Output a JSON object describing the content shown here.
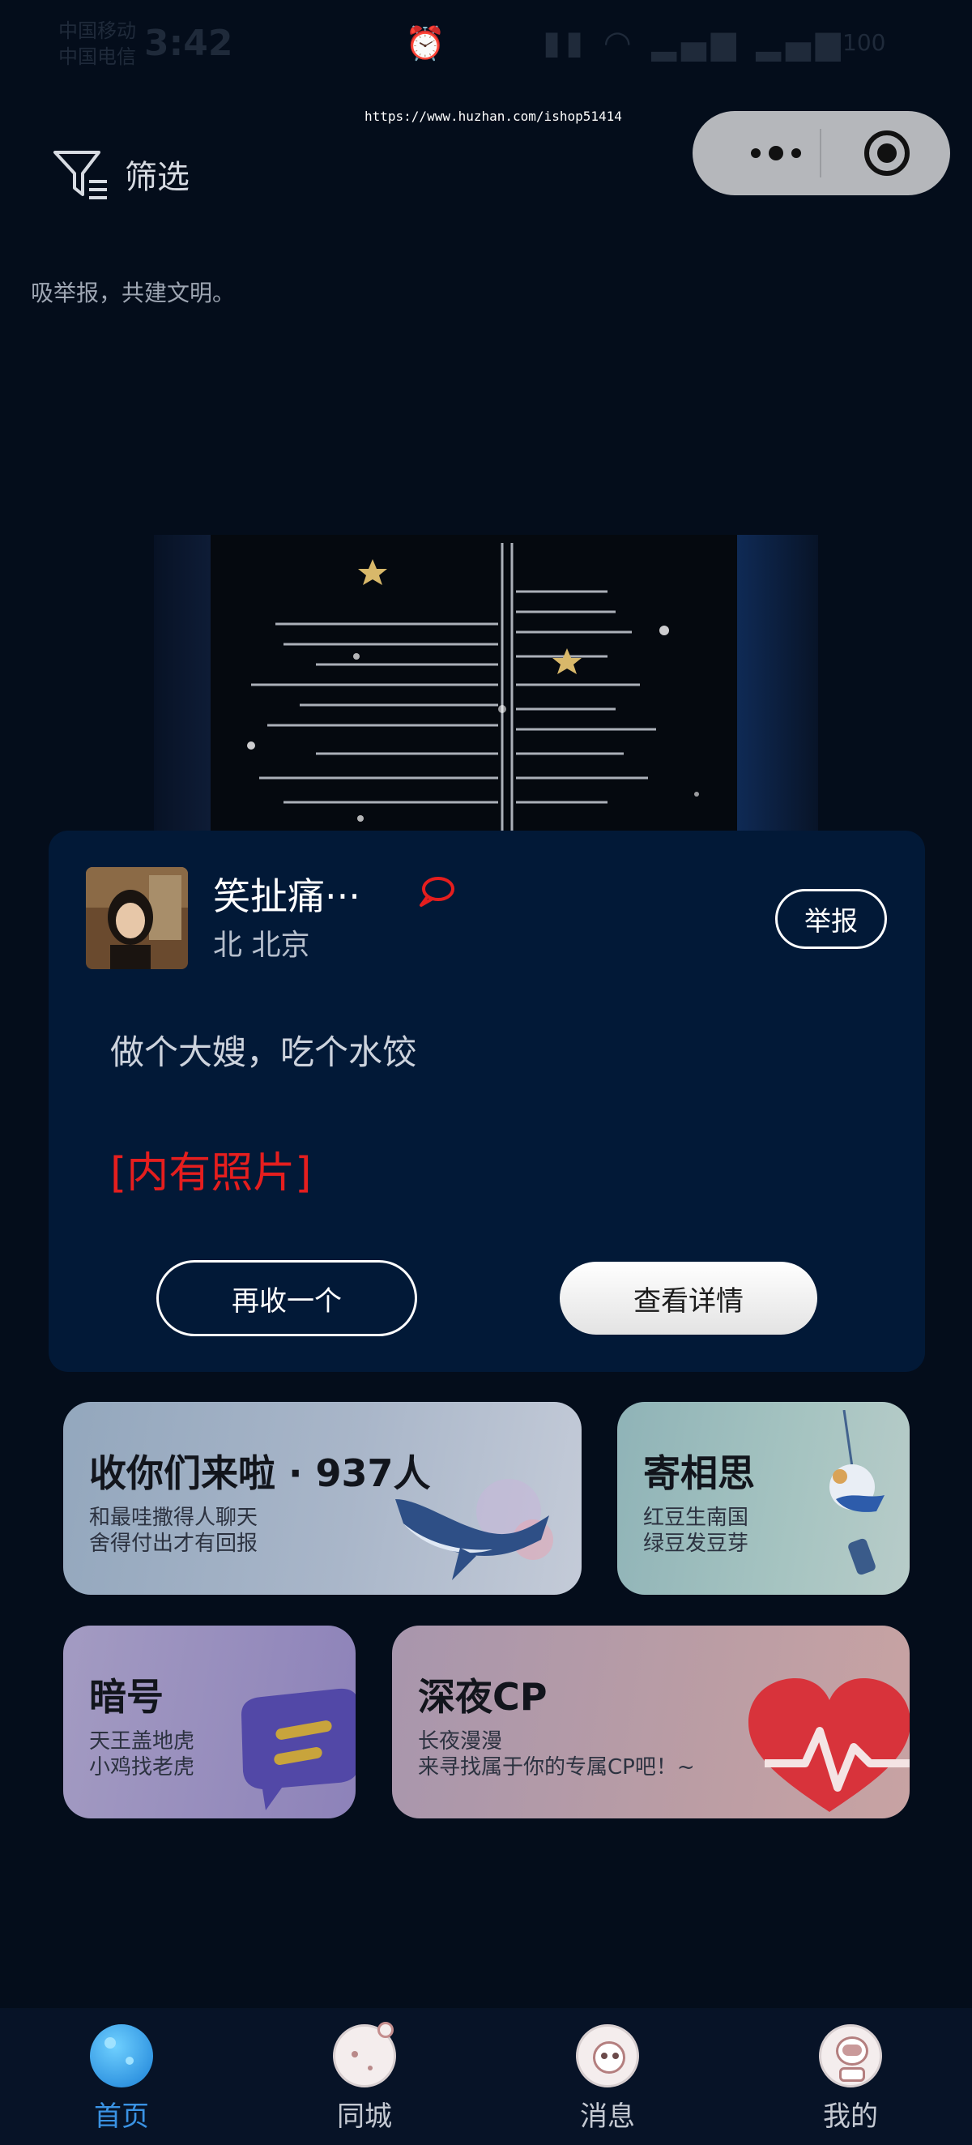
{
  "status_bar": {
    "carrier_line1": "中国移动",
    "carrier_line2": "中国电信",
    "time": "3:42",
    "battery": "100"
  },
  "watermark": "https://www.huzhan.com/ishop51414",
  "filter": {
    "label": "筛选",
    "icon": "filter-icon"
  },
  "notice": "吸举报，共建文明。",
  "card": {
    "username": "笑扯痛···",
    "location": "北 北京",
    "report_label": "举报",
    "message": "做个大嫂，吃个水饺",
    "photo_tag": "[内有照片]",
    "again_label": "再收一个",
    "detail_label": "查看详情"
  },
  "tiles": [
    {
      "title": "收你们来啦 · 937人",
      "line1": "和最哇撒得人聊天",
      "line2": "舍得付出才有回报",
      "icon": "whale-icon"
    },
    {
      "title": "寄相思",
      "line1": "红豆生南国",
      "line2": "绿豆发豆芽",
      "icon": "ornament-icon"
    },
    {
      "title": "暗号",
      "line1": "天王盖地虎",
      "line2": "小鸡找老虎",
      "icon": "chat-bubble-icon"
    },
    {
      "title": "深夜CP",
      "line1": "长夜漫漫",
      "line2": "来寻找属于你的专属CP吧！~",
      "icon": "heart-pulse-icon"
    }
  ],
  "tabbar": {
    "items": [
      {
        "label": "首页",
        "icon": "planet-home-icon",
        "active": true
      },
      {
        "label": "同城",
        "icon": "moon-icon",
        "active": false
      },
      {
        "label": "消息",
        "icon": "alien-icon",
        "active": false
      },
      {
        "label": "我的",
        "icon": "astronaut-icon",
        "active": false
      }
    ]
  },
  "colors": {
    "background": "#040d1b",
    "card": "#021937",
    "accent_red": "#e51e1e",
    "tab_active": "#3a93e4"
  }
}
